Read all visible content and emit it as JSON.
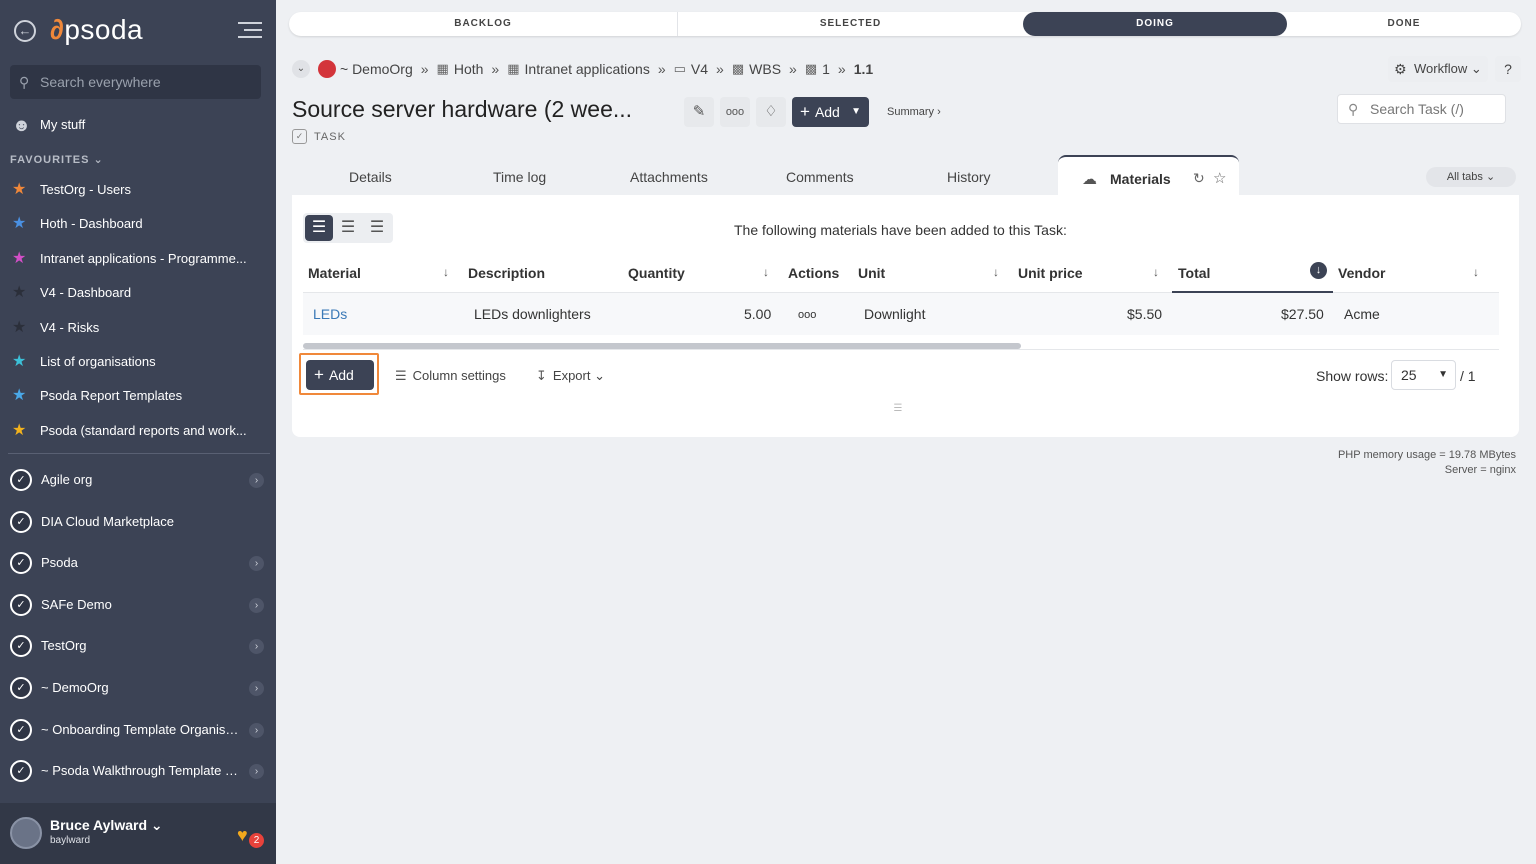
{
  "sidebar": {
    "logo": "psoda",
    "search_placeholder": "Search everywhere",
    "my_stuff": "My stuff",
    "favourites_header": "FAVOURITES",
    "favourites": [
      {
        "label": "TestOrg - Users",
        "color": "#f0883a"
      },
      {
        "label": "Hoth - Dashboard",
        "color": "#4a90e2"
      },
      {
        "label": "Intranet applications - Programme...",
        "color": "#d24fc7"
      },
      {
        "label": "V4 - Dashboard",
        "color": "#2b2f3a"
      },
      {
        "label": "V4 - Risks",
        "color": "#2b2f3a"
      },
      {
        "label": "List of organisations",
        "color": "#3cc0d8"
      },
      {
        "label": "Psoda Report Templates",
        "color": "#4aa8e8"
      },
      {
        "label": "Psoda (standard reports and work...",
        "color": "#f2b21d"
      }
    ],
    "orgs": [
      {
        "label": "Agile org",
        "chevron": true
      },
      {
        "label": "DIA Cloud Marketplace",
        "chevron": false
      },
      {
        "label": "Psoda",
        "chevron": true
      },
      {
        "label": "SAFe Demo",
        "chevron": true
      },
      {
        "label": "TestOrg",
        "chevron": true
      },
      {
        "label": "~ DemoOrg",
        "chevron": true
      },
      {
        "label": "~ Onboarding Template Organisa...",
        "chevron": true
      },
      {
        "label": "~ Psoda Walkthrough Template P...",
        "chevron": true
      }
    ],
    "user": {
      "name": "Bruce Aylward",
      "handle": "baylward",
      "notifications": "2"
    }
  },
  "progress": {
    "stages": [
      "BACKLOG",
      "SELECTED",
      "DOING",
      "DONE"
    ],
    "active": "DOING"
  },
  "breadcrumb": {
    "items": [
      "~ DemoOrg",
      "Hoth",
      "Intranet applications",
      "V4",
      "WBS",
      "1",
      "1.1"
    ]
  },
  "header": {
    "workflow": "Workflow",
    "help": "?",
    "title": "Source server hardware (2 wee...",
    "type": "TASK",
    "add": "Add",
    "summary": "Summary",
    "search_placeholder": "Search Task (/)"
  },
  "tabs": {
    "items": [
      "Details",
      "Time log",
      "Attachments",
      "Comments",
      "History"
    ],
    "active": "Materials",
    "all_tabs": "All tabs"
  },
  "materials": {
    "intro": "The following materials have been added to this Task:",
    "columns": [
      "Material",
      "Description",
      "Quantity",
      "Actions",
      "Unit",
      "Unit price",
      "Total",
      "Vendor"
    ],
    "rows": [
      {
        "material": "LEDs",
        "description": "LEDs downlighters",
        "quantity": "5.00",
        "actions": "ooo",
        "unit": "Downlight",
        "unit_price": "$5.50",
        "total": "$27.50",
        "vendor": "Acme"
      }
    ],
    "add": "Add",
    "column_settings": "Column settings",
    "export": "Export",
    "show_rows_label": "Show rows:",
    "show_rows_value": "25",
    "page_count": "/ 1"
  },
  "footer": {
    "memory": "PHP memory usage = 19.78 MBytes",
    "server": "Server = nginx"
  }
}
